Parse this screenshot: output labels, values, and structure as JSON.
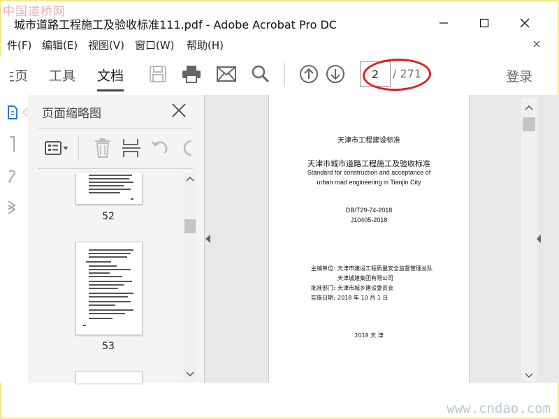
{
  "watermarks": {
    "top_left": "中国道桥网",
    "bottom_right": "www.cndao.com"
  },
  "window": {
    "title": "城市道路工程施工及验收标准111.pdf - Adobe Acrobat Pro DC"
  },
  "menu": [
    {
      "label": "件(F)"
    },
    {
      "label": "编辑(E)"
    },
    {
      "label": "视图(V)"
    },
    {
      "label": "窗口(W)"
    },
    {
      "label": "帮助(H)"
    }
  ],
  "toolbar": {
    "tabs": [
      {
        "label": "主页"
      },
      {
        "label": "工具"
      },
      {
        "label": "文档"
      }
    ],
    "icons": [
      "save-icon",
      "print-icon",
      "email-icon",
      "search-icon",
      "prev-page-icon",
      "next-page-icon"
    ],
    "current_page": "2",
    "total_pages": "/ 271",
    "login": "登录"
  },
  "panel": {
    "title": "页面缩略图",
    "thumbnails": [
      {
        "page": "52"
      },
      {
        "page": "53"
      }
    ]
  },
  "document": {
    "header": "天津市工程建设标准",
    "title_cn": "天津市城市道路工程施工及验收标准",
    "title_en_1": "Standard for construction and acceptance of",
    "title_en_2": "urban road engineering in Tianjin City",
    "code_1": "DB/T29-74-2018",
    "code_2": "J10405-2018",
    "info": [
      {
        "label": "主编单位:",
        "value": "天津市建设工程质量安全监督管理总队"
      },
      {
        "label": "",
        "value": "天津城建集团有限公司"
      },
      {
        "label": "批准部门:",
        "value": "天津市城乡建设委员会"
      },
      {
        "label": "实施日期:",
        "value": "2018 年 10 月 1 日"
      }
    ],
    "footer": "2018 天 津"
  },
  "colors": {
    "highlight": "#e02020",
    "active_tab_underline": "#444444"
  }
}
